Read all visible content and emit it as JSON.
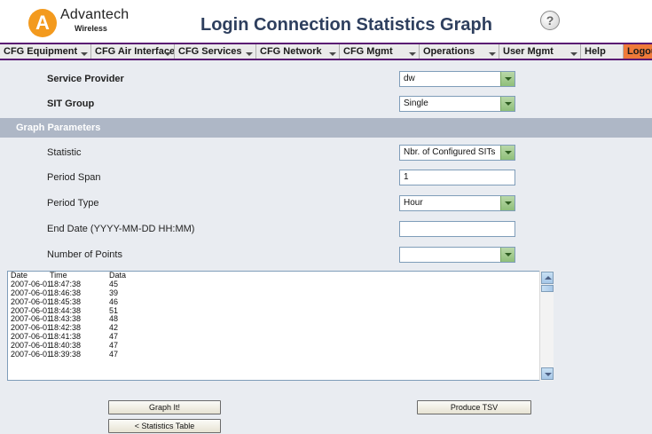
{
  "header": {
    "logo_letter": "A",
    "logo_name": "Advantech",
    "logo_sub": "Wireless",
    "title": "Login Connection Statistics Graph",
    "help_symbol": "?"
  },
  "nav": {
    "items": [
      {
        "label": "CFG Equipment",
        "dropdown": true
      },
      {
        "label": "CFG Air Interface",
        "dropdown": true
      },
      {
        "label": "CFG Services",
        "dropdown": true
      },
      {
        "label": "CFG Network",
        "dropdown": true
      },
      {
        "label": "CFG Mgmt",
        "dropdown": true
      },
      {
        "label": "Operations",
        "dropdown": true
      },
      {
        "label": "User Mgmt",
        "dropdown": true
      },
      {
        "label": "Help",
        "dropdown": false
      },
      {
        "label": "Logout",
        "dropdown": false
      }
    ]
  },
  "form": {
    "service_provider": {
      "label": "Service Provider",
      "value": "dw"
    },
    "sit_group": {
      "label": "SIT Group",
      "value": "Single"
    },
    "section_title": "Graph Parameters",
    "statistic": {
      "label": "Statistic",
      "value": "Nbr. of Configured SITs"
    },
    "period_span": {
      "label": "Period Span",
      "value": "1"
    },
    "period_type": {
      "label": "Period Type",
      "value": "Hour"
    },
    "end_date": {
      "label": "End Date (YYYY-MM-DD HH:MM)",
      "value": ""
    },
    "number_of_points": {
      "label": "Number of Points",
      "value": ""
    }
  },
  "data_table": {
    "headers": [
      "Date",
      "Time",
      "Data"
    ],
    "rows": [
      [
        "2007-06-01",
        "18:47:38",
        "45"
      ],
      [
        "2007-06-01",
        "18:46:38",
        "39"
      ],
      [
        "2007-06-01",
        "18:45:38",
        "46"
      ],
      [
        "2007-06-01",
        "18:44:38",
        "51"
      ],
      [
        "2007-06-01",
        "18:43:38",
        "48"
      ],
      [
        "2007-06-01",
        "18:42:38",
        "42"
      ],
      [
        "2007-06-01",
        "18:41:38",
        "47"
      ],
      [
        "2007-06-01",
        "18:40:38",
        "47"
      ],
      [
        "2007-06-01",
        "18:39:38",
        "47"
      ]
    ]
  },
  "buttons": {
    "graph_it": "Graph It!",
    "statistics_table": "< Statistics Table",
    "produce_tsv": "Produce TSV"
  },
  "colors": {
    "nav_border": "#5a1a73",
    "logout_bg": "#ef7a3a",
    "title": "#2e3f5e",
    "section_bar": "#aeb7c6",
    "content_bg": "#e9ecf1",
    "logo": "#f39a1e"
  }
}
